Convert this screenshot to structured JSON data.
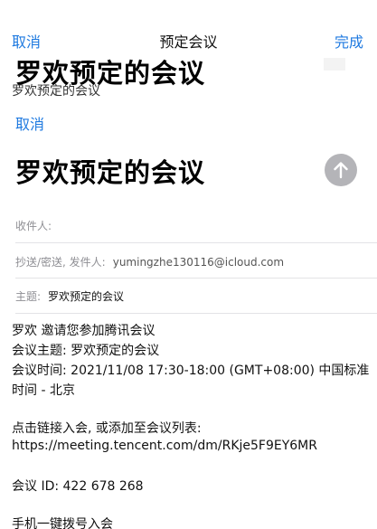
{
  "nav": {
    "cancel_label": "取消",
    "title": "预定会议",
    "done_label": "完成"
  },
  "header": {
    "ghost_title": "罗欢预定的会议",
    "subtitle": "罗欢预定的会议"
  },
  "compose": {
    "cancel_label": "取消",
    "title": "罗欢预定的会议",
    "send_icon": "arrow-up-icon",
    "send_button_color": "#b4b4b8",
    "to_label": "收件人:",
    "cc_label": "抄送/密送, 发件人:",
    "from_email": "yumingzhe130116@icloud.com",
    "subject_label": "主题:",
    "subject_value": "罗欢预定的会议"
  },
  "body": {
    "lines": [
      "罗欢 邀请您参加腾讯会议",
      "会议主题: 罗欢预定的会议",
      "会议时间: 2021/11/08 17:30-18:00 (GMT+08:00) 中国标准",
      "时间 - 北京",
      "",
      "点击链接入会, 或添加至会议列表:",
      "https://meeting.tencent.com/dm/RKje5F9EY6MR",
      "",
      "会议 ID: 422 678 268",
      "",
      "手机一键拨号入会"
    ]
  },
  "colors": {
    "accent": "#1f7ae0",
    "muted_text": "#8e8e93"
  }
}
